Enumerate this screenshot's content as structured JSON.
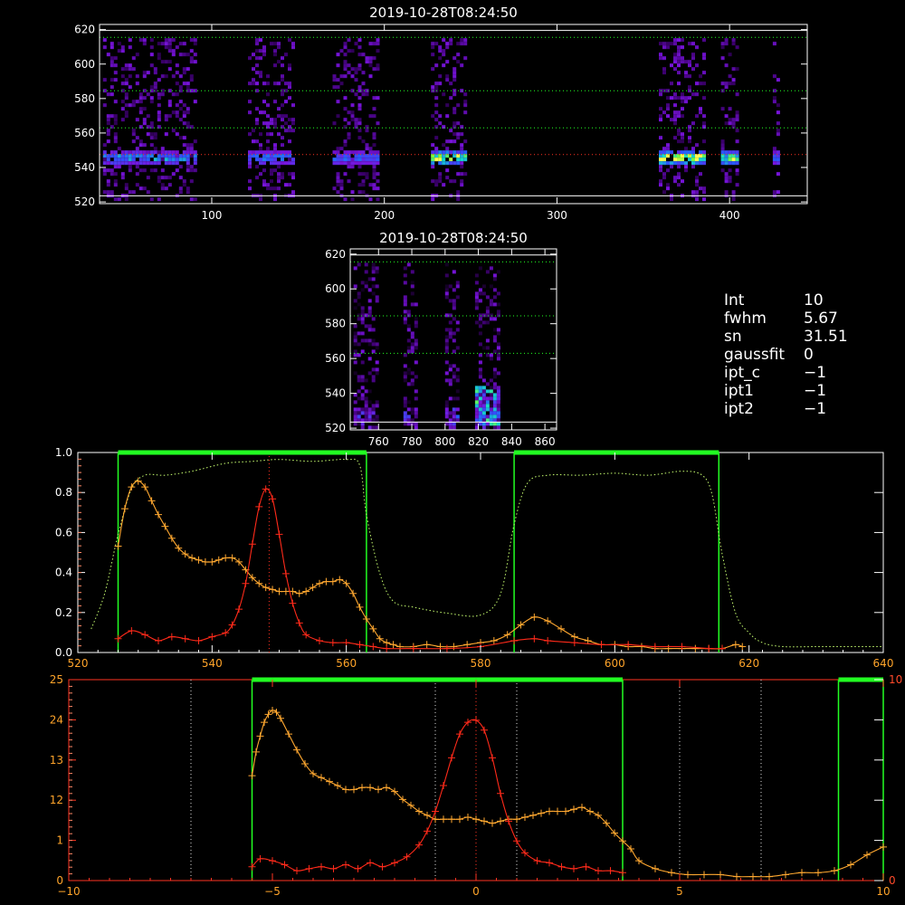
{
  "colors": {
    "background": "#000000",
    "frame": "#ffffff",
    "guide_green": "#22ff22",
    "guide_red": "#ff3322",
    "spectrum_orange": "#ffa830",
    "profile_red": "#ff2a1a",
    "transmission_green": "#c8ff70",
    "dotted_white": "#dddddd"
  },
  "params": [
    {
      "key": "Int",
      "value": "10"
    },
    {
      "key": "fwhm",
      "value": "5.67"
    },
    {
      "key": "sn",
      "value": "31.51"
    },
    {
      "key": "gaussfit",
      "value": "0"
    },
    {
      "key": "ipt_c",
      "value": "−1"
    },
    {
      "key": "ipt1",
      "value": "−1"
    },
    {
      "key": "ipt2",
      "value": "−1"
    }
  ],
  "chart_data": [
    {
      "type": "heatmap",
      "title": "2019-10-28T08:24:50",
      "xlim": [
        35,
        445
      ],
      "ylim": [
        519,
        623
      ],
      "x_ticks": [
        100,
        200,
        300,
        400
      ],
      "y_ticks": [
        520,
        540,
        560,
        580,
        600,
        620
      ],
      "guides": {
        "white_y": [
          523.5,
          619.5
        ],
        "green_y": [
          563,
          584.5,
          615.5
        ],
        "red_y": [
          547.5
        ]
      },
      "bands": [
        {
          "x": [
            37,
            90
          ],
          "peak": 0.55
        },
        {
          "x": [
            121,
            148
          ],
          "peak": 0.5
        },
        {
          "x": [
            170,
            196
          ],
          "peak": 0.45
        },
        {
          "x": [
            227,
            246
          ],
          "peak": 0.9
        },
        {
          "x": [
            359,
            386
          ],
          "peak": 0.9
        },
        {
          "x": [
            395,
            405
          ],
          "peak": 0.8
        },
        {
          "x": [
            425,
            429
          ],
          "peak": 0.5
        }
      ]
    },
    {
      "type": "heatmap",
      "title": "2019-10-28T08:24:50",
      "xlim": [
        743,
        867
      ],
      "ylim": [
        519,
        623
      ],
      "x_ticks": [
        760,
        780,
        800,
        820,
        840,
        860
      ],
      "y_ticks": [
        520,
        540,
        560,
        580,
        600,
        620
      ],
      "guides": {
        "white_y": [
          523.5,
          619.5
        ],
        "green_y": [
          563,
          584.5,
          615.5
        ]
      },
      "bands": [
        {
          "x": [
            745,
            760
          ],
          "peak": 0.35
        },
        {
          "x": [
            775,
            782
          ],
          "peak": 0.3
        },
        {
          "x": [
            800,
            808
          ],
          "peak": 0.6
        },
        {
          "x": [
            818,
            832
          ],
          "peak": 0.9
        }
      ]
    },
    {
      "type": "line",
      "xlim": [
        520,
        640
      ],
      "ylim": [
        0,
        1.0
      ],
      "x_ticks": [
        520,
        540,
        560,
        580,
        600,
        620,
        640
      ],
      "y_ticks_left": [
        "0.0",
        "0.2",
        "0.4",
        "0.6",
        "0.8",
        "1.0"
      ],
      "green_boxes": [
        [
          526,
          563
        ],
        [
          585,
          615.5
        ]
      ],
      "red_center": 548.5,
      "series": [
        {
          "key": "transmission",
          "style": "dotted",
          "color": "#c8ff70",
          "x": [
            522,
            524,
            526,
            528,
            530,
            533,
            537,
            542,
            546,
            550,
            555,
            560,
            562,
            563,
            565,
            567,
            570,
            575,
            580,
            583,
            585,
            587,
            590,
            595,
            600,
            605,
            610,
            613,
            614.5,
            616,
            618,
            620,
            622,
            625,
            630,
            635,
            640
          ],
          "y": [
            0.12,
            0.3,
            0.6,
            0.83,
            0.9,
            0.9,
            0.92,
            0.96,
            0.97,
            0.98,
            0.97,
            0.98,
            0.95,
            0.7,
            0.4,
            0.26,
            0.23,
            0.2,
            0.19,
            0.3,
            0.65,
            0.86,
            0.9,
            0.9,
            0.91,
            0.9,
            0.92,
            0.9,
            0.8,
            0.5,
            0.2,
            0.1,
            0.05,
            0.03,
            0.03,
            0.03,
            0.03
          ]
        },
        {
          "key": "spectrum",
          "style": "plus",
          "color": "#ffa830",
          "x": [
            526,
            527,
            528,
            529,
            530,
            531,
            532,
            533,
            534,
            535,
            536,
            537,
            538,
            539,
            540,
            541,
            542,
            543,
            544,
            545,
            546,
            547,
            548,
            549,
            550,
            551,
            552,
            553,
            554,
            555,
            556,
            557,
            558,
            559,
            560,
            561,
            562,
            563,
            564,
            565,
            566,
            567,
            568,
            570,
            572,
            574,
            576,
            578,
            580,
            582,
            584,
            586,
            588,
            590,
            592,
            594,
            596,
            598,
            600,
            602,
            604,
            606,
            608,
            610,
            612,
            614,
            616,
            618,
            619
          ],
          "y": [
            0.54,
            0.73,
            0.84,
            0.87,
            0.84,
            0.77,
            0.7,
            0.64,
            0.58,
            0.53,
            0.5,
            0.48,
            0.47,
            0.46,
            0.46,
            0.47,
            0.48,
            0.48,
            0.46,
            0.42,
            0.38,
            0.35,
            0.33,
            0.32,
            0.31,
            0.31,
            0.31,
            0.3,
            0.31,
            0.33,
            0.35,
            0.36,
            0.36,
            0.37,
            0.35,
            0.3,
            0.23,
            0.17,
            0.12,
            0.07,
            0.05,
            0.04,
            0.03,
            0.03,
            0.04,
            0.03,
            0.03,
            0.04,
            0.05,
            0.06,
            0.09,
            0.14,
            0.18,
            0.16,
            0.12,
            0.08,
            0.06,
            0.04,
            0.04,
            0.03,
            0.03,
            0.02,
            0.02,
            0.02,
            0.02,
            0.02,
            0.02,
            0.04,
            0.03
          ]
        },
        {
          "key": "profile",
          "style": "plus",
          "color": "#ff2a1a",
          "x": [
            526,
            528,
            530,
            532,
            534,
            536,
            538,
            540,
            542,
            543,
            544,
            545,
            546,
            547,
            548,
            549,
            550,
            551,
            552,
            553,
            554,
            556,
            558,
            560,
            562,
            564,
            566,
            570,
            575,
            580,
            585,
            588,
            590,
            594,
            598,
            602,
            606,
            610,
            614,
            616
          ],
          "y": [
            0.07,
            0.11,
            0.09,
            0.06,
            0.08,
            0.07,
            0.06,
            0.08,
            0.1,
            0.14,
            0.22,
            0.35,
            0.55,
            0.74,
            0.83,
            0.78,
            0.6,
            0.4,
            0.25,
            0.15,
            0.09,
            0.06,
            0.05,
            0.05,
            0.04,
            0.03,
            0.02,
            0.02,
            0.02,
            0.03,
            0.06,
            0.07,
            0.06,
            0.05,
            0.04,
            0.04,
            0.03,
            0.03,
            0.02,
            0.02
          ]
        }
      ]
    },
    {
      "type": "line",
      "xlim": [
        -10,
        10
      ],
      "ylim": [
        0,
        1.0
      ],
      "x_ticks": [
        "−10",
        "−5",
        "0",
        "5",
        "10"
      ],
      "x_tick_values": [
        -10,
        -5,
        0,
        5,
        10
      ],
      "y_ticks_left": [
        "0",
        "1",
        "12",
        "13",
        "24",
        "25"
      ],
      "y_ticks_right": [
        "0",
        "10"
      ],
      "green_boxes": [
        [
          -5.5,
          3.6
        ],
        [
          8.9,
          10
        ]
      ],
      "white_dotted_x": [
        -7,
        -1,
        1,
        5,
        7
      ],
      "red_center": 0,
      "series": [
        {
          "key": "spectrum",
          "style": "plus",
          "color": "#ffa830",
          "x": [
            -5.5,
            -5.4,
            -5.3,
            -5.2,
            -5.1,
            -5.0,
            -4.9,
            -4.8,
            -4.6,
            -4.4,
            -4.2,
            -4.0,
            -3.8,
            -3.6,
            -3.4,
            -3.2,
            -3.0,
            -2.8,
            -2.6,
            -2.4,
            -2.2,
            -2.0,
            -1.8,
            -1.6,
            -1.4,
            -1.2,
            -1.0,
            -0.8,
            -0.6,
            -0.4,
            -0.2,
            0.0,
            0.2,
            0.4,
            0.6,
            0.8,
            1.0,
            1.2,
            1.4,
            1.6,
            1.8,
            2.0,
            2.2,
            2.4,
            2.6,
            2.8,
            3.0,
            3.2,
            3.4,
            3.6,
            3.8,
            4.0,
            4.4,
            4.8,
            5.2,
            5.6,
            6.0,
            6.4,
            6.8,
            7.2,
            7.6,
            8.0,
            8.4,
            8.8,
            9.2,
            9.6,
            10.0
          ],
          "y": [
            0.53,
            0.65,
            0.73,
            0.8,
            0.84,
            0.86,
            0.85,
            0.82,
            0.74,
            0.66,
            0.59,
            0.54,
            0.52,
            0.5,
            0.48,
            0.46,
            0.46,
            0.47,
            0.47,
            0.46,
            0.47,
            0.45,
            0.41,
            0.38,
            0.35,
            0.33,
            0.31,
            0.31,
            0.31,
            0.31,
            0.32,
            0.31,
            0.3,
            0.29,
            0.3,
            0.31,
            0.31,
            0.32,
            0.33,
            0.34,
            0.35,
            0.35,
            0.35,
            0.36,
            0.37,
            0.35,
            0.33,
            0.29,
            0.24,
            0.2,
            0.16,
            0.1,
            0.06,
            0.04,
            0.03,
            0.03,
            0.03,
            0.02,
            0.02,
            0.02,
            0.03,
            0.04,
            0.04,
            0.05,
            0.08,
            0.13,
            0.17
          ]
        },
        {
          "key": "profile",
          "style": "plus",
          "color": "#ff2a1a",
          "x": [
            -5.5,
            -5.3,
            -5.0,
            -4.7,
            -4.4,
            -4.1,
            -3.8,
            -3.5,
            -3.2,
            -2.9,
            -2.6,
            -2.3,
            -2.0,
            -1.7,
            -1.4,
            -1.2,
            -1.0,
            -0.8,
            -0.6,
            -0.4,
            -0.2,
            0.0,
            0.2,
            0.4,
            0.6,
            0.8,
            1.0,
            1.2,
            1.5,
            1.8,
            2.1,
            2.4,
            2.7,
            3.0,
            3.3,
            3.6
          ],
          "y": [
            0.07,
            0.11,
            0.1,
            0.08,
            0.05,
            0.06,
            0.07,
            0.06,
            0.08,
            0.06,
            0.09,
            0.07,
            0.09,
            0.12,
            0.18,
            0.25,
            0.35,
            0.48,
            0.62,
            0.74,
            0.8,
            0.81,
            0.76,
            0.62,
            0.44,
            0.3,
            0.2,
            0.14,
            0.1,
            0.09,
            0.07,
            0.06,
            0.07,
            0.05,
            0.05,
            0.04
          ]
        }
      ]
    }
  ]
}
